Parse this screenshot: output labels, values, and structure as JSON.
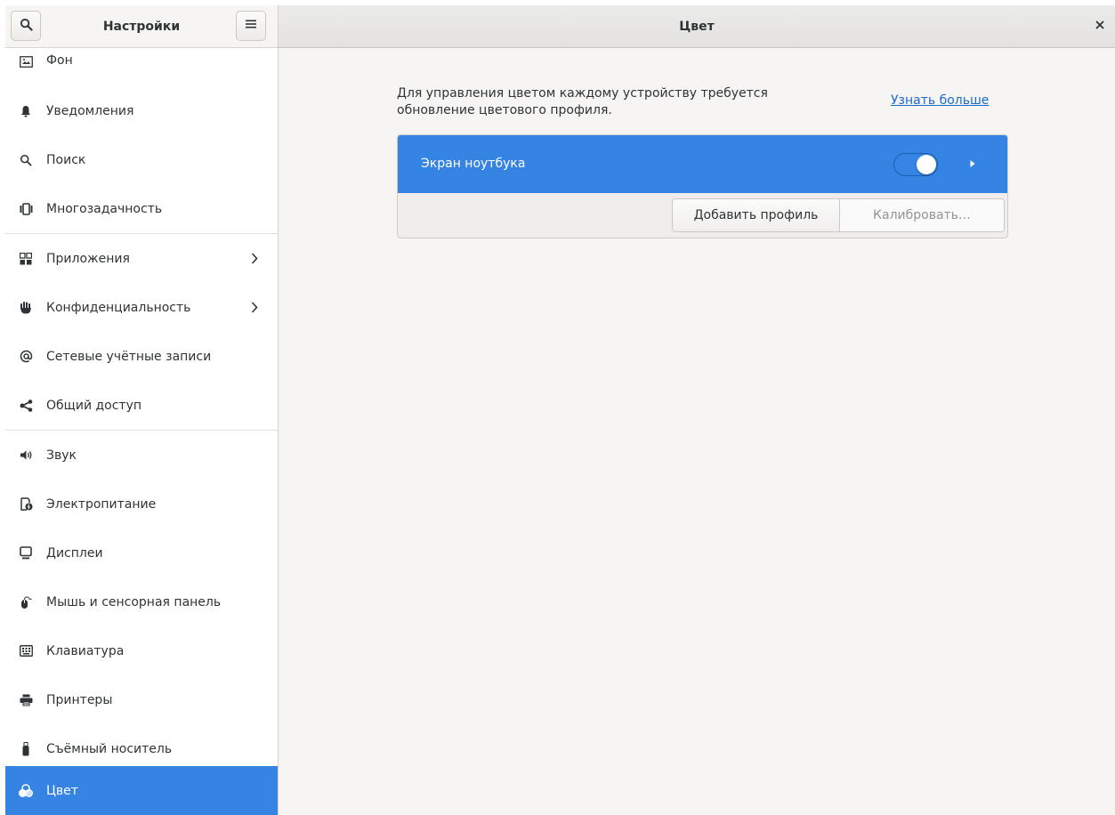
{
  "header": {
    "sidebar_title": "Настройки",
    "panel_title": "Цвет"
  },
  "sidebar": {
    "items": [
      {
        "label": "Фон",
        "icon": "background-icon"
      },
      {
        "label": "Уведомления",
        "icon": "bell-icon"
      },
      {
        "label": "Поиск",
        "icon": "search-icon"
      },
      {
        "label": "Многозадачность",
        "icon": "multitasking-icon"
      },
      {
        "label": "Приложения",
        "icon": "apps-grid-icon",
        "has_submenu": true
      },
      {
        "label": "Конфиденциальность",
        "icon": "hand-icon",
        "has_submenu": true
      },
      {
        "label": "Сетевые учётные записи",
        "icon": "at-sign-icon"
      },
      {
        "label": "Общий доступ",
        "icon": "share-icon"
      },
      {
        "label": "Звук",
        "icon": "speaker-icon"
      },
      {
        "label": "Электропитание",
        "icon": "power-icon"
      },
      {
        "label": "Дисплеи",
        "icon": "display-icon"
      },
      {
        "label": "Мышь и сенсорная панель",
        "icon": "mouse-icon"
      },
      {
        "label": "Клавиатура",
        "icon": "keyboard-icon"
      },
      {
        "label": "Принтеры",
        "icon": "printer-icon"
      },
      {
        "label": "Съёмный носитель",
        "icon": "usb-drive-icon"
      },
      {
        "label": "Цвет",
        "icon": "color-icon",
        "selected": true
      }
    ]
  },
  "main": {
    "info_line1": "Для управления цветом каждому устройству требуется",
    "info_line2": "обновление цветового профиля.",
    "learn_more": "Узнать больше",
    "device": {
      "name": "Экран ноутбука",
      "enabled": true
    },
    "add_profile": "Добавить профиль",
    "calibrate": "Калибровать…"
  },
  "colors": {
    "accent": "#3584e4",
    "link": "#1b6acb",
    "window_bg": "#f6f5f4",
    "sidebar_bg": "#ffffff"
  }
}
